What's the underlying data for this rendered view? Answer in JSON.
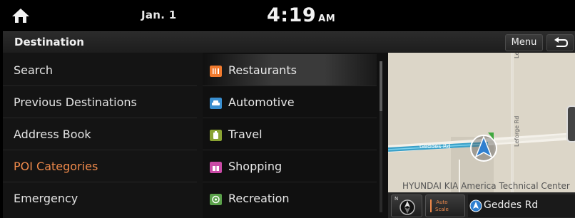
{
  "status_bar": {
    "date": "Jan. 1",
    "time": "4:19",
    "ampm": "AM"
  },
  "header": {
    "title": "Destination",
    "menu_label": "Menu"
  },
  "left_menu": {
    "items": [
      {
        "label": "Search"
      },
      {
        "label": "Previous Destinations"
      },
      {
        "label": "Address Book"
      },
      {
        "label": "POI Categories",
        "active": true
      },
      {
        "label": "Emergency"
      }
    ]
  },
  "categories": {
    "items": [
      {
        "label": "Restaurants",
        "icon": "restaurant-icon",
        "color": "#f07a2e",
        "selected": true
      },
      {
        "label": "Automotive",
        "icon": "car-icon",
        "color": "#3a8fd0"
      },
      {
        "label": "Travel",
        "icon": "luggage-icon",
        "color": "#8aa332"
      },
      {
        "label": "Shopping",
        "icon": "gift-icon",
        "color": "#c94aa6"
      },
      {
        "label": "Recreation",
        "icon": "recreation-icon",
        "color": "#5aa04a"
      }
    ]
  },
  "map": {
    "poi_label": "HYUNDAI KIA America Technical Center",
    "road_name": "Geddes Rd",
    "highlighted_road": "Geddes Rd",
    "street_labels": [
      "Leforge",
      "Leforge Rd"
    ],
    "scale_label_1": "Auto",
    "scale_label_2": "Scale",
    "compass_label": "N"
  },
  "colors": {
    "accent": "#f08a4b",
    "route": "#3aa0c8"
  }
}
